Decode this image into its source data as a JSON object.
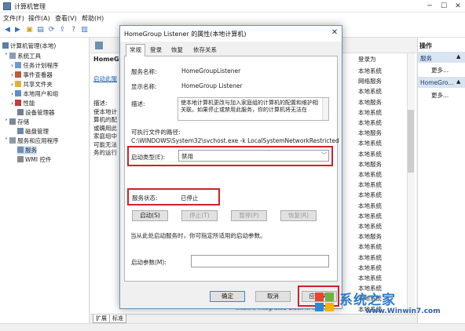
{
  "window": {
    "title": "计算机管理"
  },
  "menu": [
    "文件(F)",
    "操作(A)",
    "查看(V)",
    "帮助(H)"
  ],
  "tree": [
    {
      "label": "计算机管理(本地)",
      "level": 0
    },
    {
      "label": "系统工具",
      "level": 1
    },
    {
      "label": "任务计划程序",
      "level": 2
    },
    {
      "label": "事件查看器",
      "level": 2
    },
    {
      "label": "共享文件夹",
      "level": 2
    },
    {
      "label": "本地用户和组",
      "level": 2
    },
    {
      "label": "性能",
      "level": 2
    },
    {
      "label": "设备管理器",
      "level": 2
    },
    {
      "label": "存储",
      "level": 1
    },
    {
      "label": "磁盘管理",
      "level": 2
    },
    {
      "label": "服务和应用程序",
      "level": 1
    },
    {
      "label": "服务",
      "level": 2
    },
    {
      "label": "WMI 控件",
      "level": 2
    }
  ],
  "services_pane": {
    "title": "HomeG",
    "link": "启动此服",
    "desc_lines": [
      "描述:",
      "使本地计",
      "算机的配",
      "或确用此",
      "家庭组中",
      "可能无法",
      "务的运行"
    ]
  },
  "logon": {
    "header": "登录为",
    "cells": [
      "本地系统",
      "网络服务",
      "本地系统",
      "本地服务",
      "本地系统",
      "本地系统",
      "本地服务",
      "本地系统",
      "本地系统",
      "本地服务",
      "本地系统",
      "本地系统",
      "本地系统",
      "本地系统",
      "本地系统",
      "本地系统",
      "本地服务",
      "本地系统",
      "本地系统",
      "本地系统",
      "本地系统",
      "本地系统",
      "本地系统",
      "本地系统"
    ]
  },
  "actions": {
    "title": "操作",
    "sections": [
      {
        "label": "服务",
        "more": "更多..."
      },
      {
        "label": "HomeGro...",
        "more": "更多..."
      }
    ]
  },
  "bottom_tabs": [
    "扩展",
    "标准"
  ],
  "footer_partial": "Intel(R) Integrated Clock ... Intel...",
  "dialog": {
    "title": "HomeGroup Listener 的属性(本地计算机)",
    "tabs": [
      "常规",
      "登录",
      "恢复",
      "依存关系"
    ],
    "service_name_label": "服务名称:",
    "service_name": "HomeGroupListener",
    "display_name_label": "显示名称:",
    "display_name": "HomeGroup Listener",
    "description_label": "描述:",
    "description": "使本地计算机更改与加入家庭组的计算机的配置和维护相关联。如果停止或禁用此服务，你的计算机将无法在",
    "path_label": "可执行文件的路径:",
    "path": "C:\\WINDOWS\\System32\\svchost.exe -k LocalSystemNetworkRestricted",
    "startup_type_label": "启动类型(E):",
    "startup_type": "禁用",
    "status_label": "服务状态:",
    "status": "已停止",
    "service_buttons": [
      "启动(S)",
      "停止(T)",
      "暂停(P)",
      "恢复(R)"
    ],
    "hint": "当从此处启动服务时，你可指定所适用的启动参数。",
    "param_label": "启动参数(M):",
    "param_value": "",
    "ok": "确定",
    "cancel": "取消",
    "apply": "应用(A)"
  },
  "watermark": {
    "main": "系统之家",
    "url": "www.Winwin7.com"
  },
  "colors": {
    "highlight": "#d1202a",
    "accent": "#1a5fb4",
    "action_bar": "#d9e4f2"
  }
}
